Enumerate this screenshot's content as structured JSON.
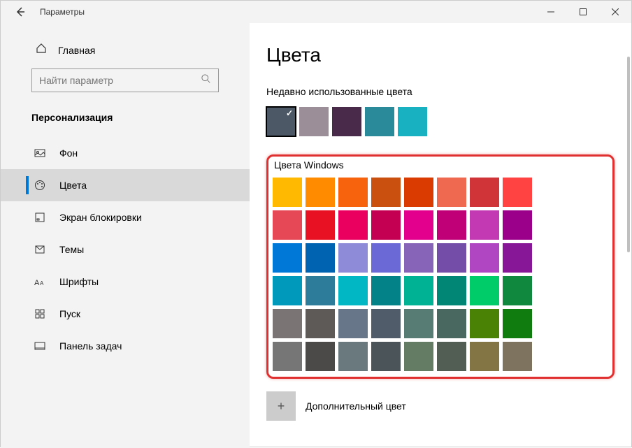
{
  "window": {
    "title": "Параметры"
  },
  "sidebar": {
    "home": "Главная",
    "search_placeholder": "Найти параметр",
    "section": "Персонализация",
    "items": [
      {
        "label": "Фон"
      },
      {
        "label": "Цвета"
      },
      {
        "label": "Экран блокировки"
      },
      {
        "label": "Темы"
      },
      {
        "label": "Шрифты"
      },
      {
        "label": "Пуск"
      },
      {
        "label": "Панель задач"
      }
    ]
  },
  "main": {
    "title": "Цвета",
    "recent_header": "Недавно использованные цвета",
    "recent_colors": [
      "#4c5866",
      "#9c8e99",
      "#4a2a4a",
      "#2b8a99",
      "#18b1c2"
    ],
    "windows_colors_header": "Цвета Windows",
    "windows_colors": [
      "#ffb900",
      "#ff8c00",
      "#f7630c",
      "#ca5010",
      "#da3b01",
      "#ef6950",
      "#d13438",
      "#ff4343",
      "#e74856",
      "#e81123",
      "#ea005e",
      "#c30052",
      "#e3008c",
      "#bf0077",
      "#c239b3",
      "#9a0089",
      "#0078d7",
      "#0063b1",
      "#8e8cd8",
      "#6b69d6",
      "#8764b8",
      "#744da9",
      "#b146c2",
      "#881798",
      "#0099bc",
      "#2d7d9a",
      "#00b7c3",
      "#038387",
      "#00b294",
      "#018574",
      "#00cc6a",
      "#10893e",
      "#7a7574",
      "#5d5a58",
      "#68768a",
      "#515c6b",
      "#567c73",
      "#486860",
      "#498205",
      "#107c10",
      "#767676",
      "#4c4a48",
      "#69797e",
      "#4a5459",
      "#647c64",
      "#525e54",
      "#847545",
      "#7e735f"
    ],
    "custom_color_label": "Дополнительный цвет"
  }
}
